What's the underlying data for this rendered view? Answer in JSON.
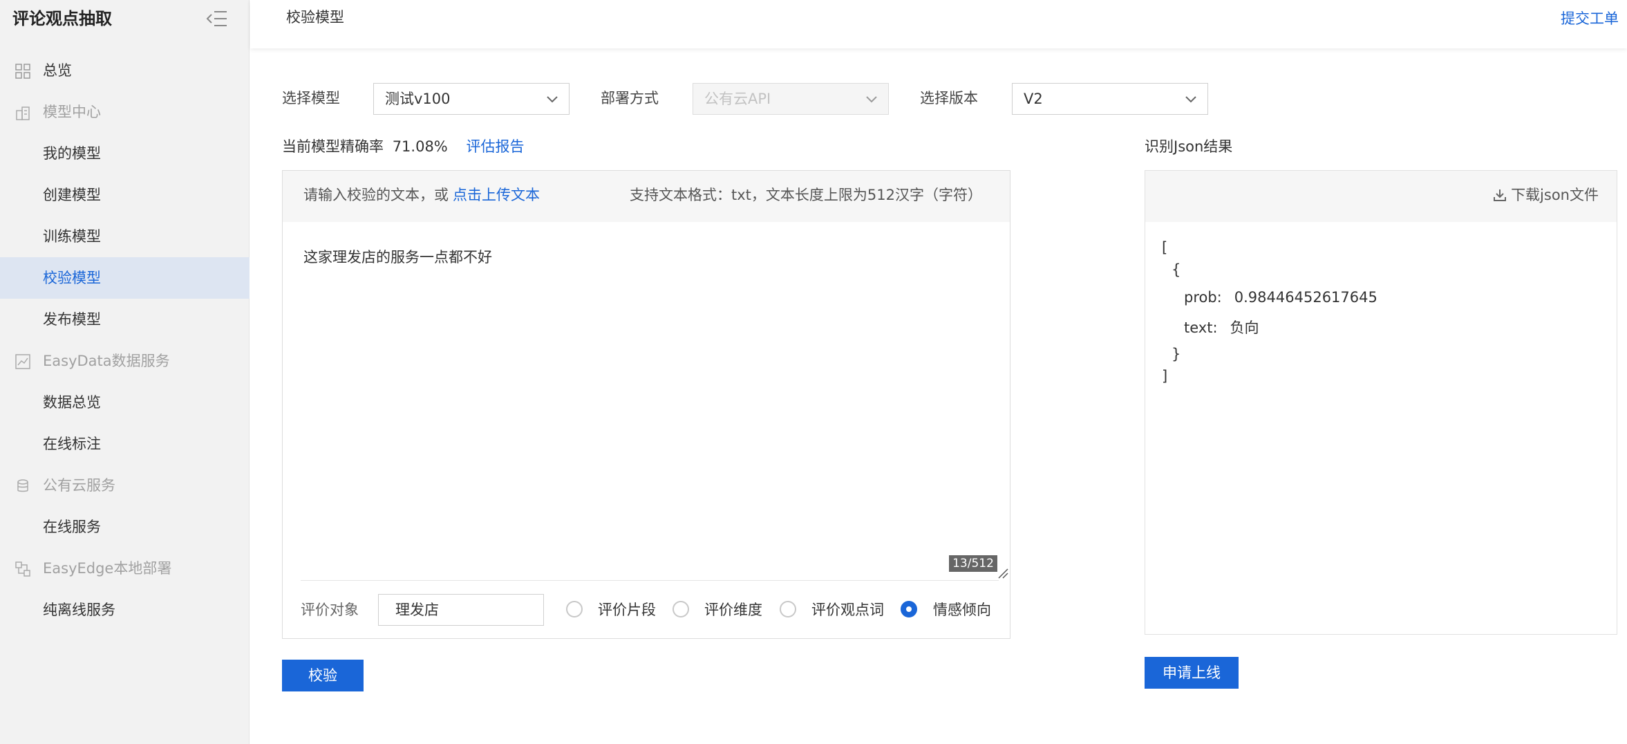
{
  "sidebar": {
    "title": "评论观点抽取",
    "items": [
      {
        "label": "总览",
        "type": "item",
        "icon": "grid-icon"
      },
      {
        "label": "模型中心",
        "type": "group",
        "icon": "building-icon"
      },
      {
        "label": "我的模型",
        "type": "sub"
      },
      {
        "label": "创建模型",
        "type": "sub"
      },
      {
        "label": "训练模型",
        "type": "sub"
      },
      {
        "label": "校验模型",
        "type": "sub",
        "active": true
      },
      {
        "label": "发布模型",
        "type": "sub"
      },
      {
        "label": "EasyData数据服务",
        "type": "group",
        "icon": "chart-icon"
      },
      {
        "label": "数据总览",
        "type": "sub"
      },
      {
        "label": "在线标注",
        "type": "sub"
      },
      {
        "label": "公有云服务",
        "type": "group",
        "icon": "database-icon"
      },
      {
        "label": "在线服务",
        "type": "sub"
      },
      {
        "label": "EasyEdge本地部署",
        "type": "group",
        "icon": "edge-icon"
      },
      {
        "label": "纯离线服务",
        "type": "sub"
      }
    ]
  },
  "topbar": {
    "title": "校验模型",
    "submit_ticket": "提交工单"
  },
  "form": {
    "model_label": "选择模型",
    "model_value": "测试v100",
    "deploy_label": "部署方式",
    "deploy_value": "公有云API",
    "version_label": "选择版本",
    "version_value": "V2"
  },
  "accuracy": {
    "label": "当前模型精确率",
    "value": "71.08%",
    "report_link": "评估报告"
  },
  "input_panel": {
    "hint": "请输入校验的文本，或",
    "upload_link": "点击上传文本",
    "format_note": "支持文本格式：txt，文本长度上限为512汉字（字符）",
    "text": "这家理发店的服务一点都不好",
    "counter": "13/512",
    "target_label": "评价对象",
    "target_value": "理发店",
    "options": [
      {
        "label": "评价片段",
        "checked": false
      },
      {
        "label": "评价维度",
        "checked": false
      },
      {
        "label": "评价观点词",
        "checked": false
      },
      {
        "label": "情感倾向",
        "checked": true
      }
    ]
  },
  "verify_button": "校验",
  "json_panel": {
    "title": "识别Json结果",
    "download": "下载json文件",
    "open_bracket": "[",
    "open_brace": "{",
    "prob_key": "prob:",
    "prob_value": "0.98446452617645",
    "text_key": "text:",
    "text_value": "负向",
    "close_brace": "}",
    "close_bracket": "]"
  },
  "apply_button": "申请上线",
  "colors": {
    "accent": "#1a66d8",
    "sidebar_bg": "#f2f2f2",
    "active_bg": "#dde5f2"
  }
}
